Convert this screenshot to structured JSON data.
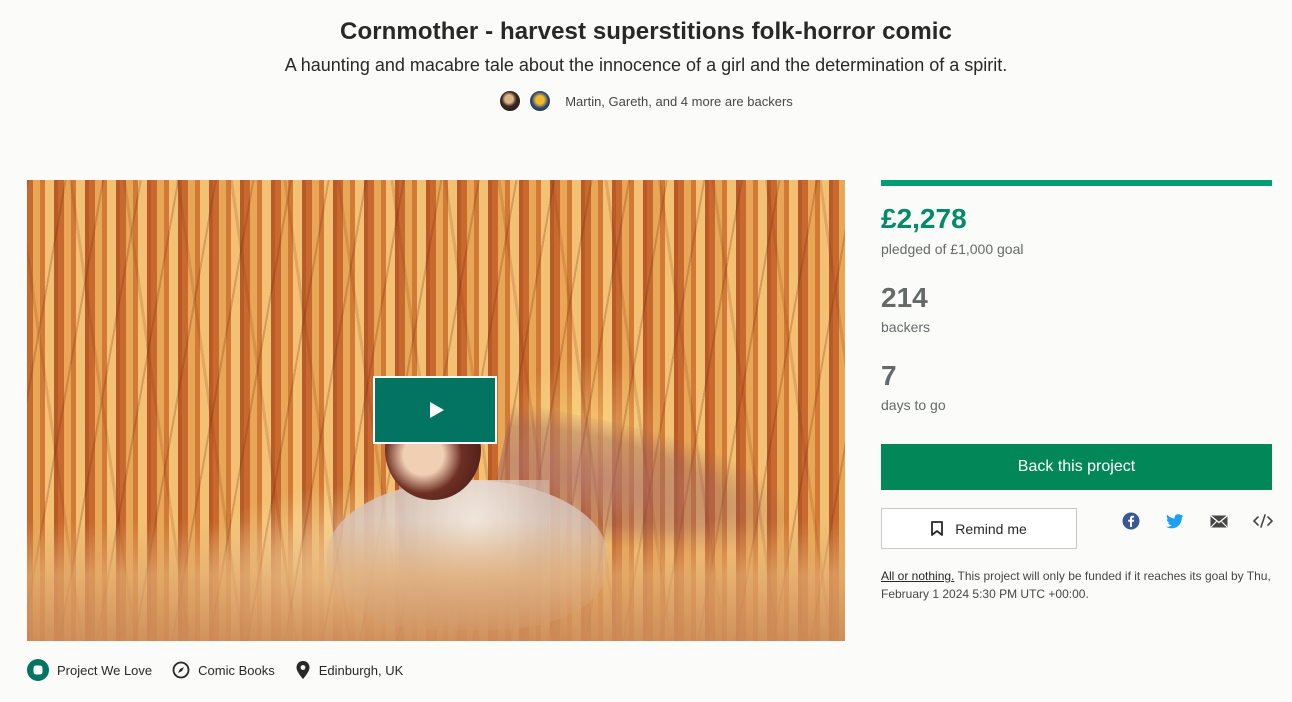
{
  "project": {
    "title": "Cornmother - harvest superstitions folk-horror comic",
    "blurb": "A haunting and macabre tale about the innocence of a girl and the determination of a spirit.",
    "backers_social": "Martin, Gareth, and 4 more are backers"
  },
  "tags": {
    "pwl": "Project We Love",
    "category": "Comic Books",
    "location": "Edinburgh, UK"
  },
  "stats": {
    "pledged": "£2,278",
    "pledged_label": "pledged of £1,000 goal",
    "backers": "214",
    "backers_label": "backers",
    "days": "7",
    "days_label": "days to go",
    "progress_fraction": 1.0
  },
  "actions": {
    "back_label": "Back this project",
    "remind_label": "Remind me"
  },
  "share_icons": [
    "facebook-icon",
    "twitter-icon",
    "email-icon",
    "embed-icon"
  ],
  "funding": {
    "link_text": "All or nothing.",
    "text": " This project will only be funded if it reaches its goal by Thu, February 1 2024 5:30 PM UTC +00:00."
  },
  "colors": {
    "accent": "#028858",
    "pledged_green": "#038b68",
    "play_button": "#037362"
  }
}
